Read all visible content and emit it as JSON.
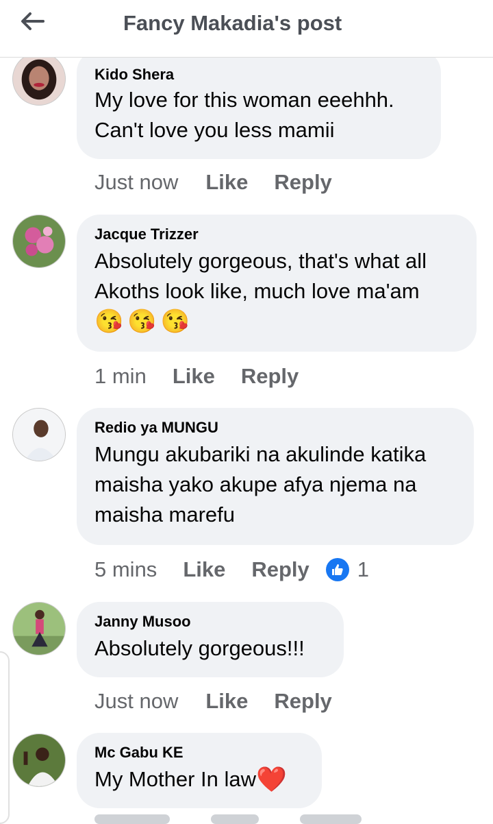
{
  "header": {
    "title": "Fancy Makadia's post"
  },
  "comments": [
    {
      "author": "Kido Shera",
      "lines": [
        "My love for this woman eeehhh.",
        "Can't love you less mamii"
      ],
      "time": "Just now",
      "like_label": "Like",
      "reply_label": "Reply"
    },
    {
      "author": "Jacque Trizzer",
      "lines": [
        "Absolutely gorgeous, that's what all",
        "Akoths look like, much love ma'am"
      ],
      "emojis": [
        "😘",
        "😘",
        "😘"
      ],
      "time": "1 min",
      "like_label": "Like",
      "reply_label": "Reply"
    },
    {
      "author": "Redio ya MUNGU",
      "lines": [
        "Mungu akubariki na akulinde katika",
        "maisha yako akupe afya njema na",
        "maisha marefu"
      ],
      "time": "5 mins",
      "like_label": "Like",
      "reply_label": "Reply",
      "reaction_count": "1"
    },
    {
      "author": "Janny Musoo",
      "lines": [
        "Absolutely gorgeous!!!"
      ],
      "time": "Just now",
      "like_label": "Like",
      "reply_label": "Reply"
    },
    {
      "author": "Mc Gabu KE",
      "lines": [
        "My Mother In law"
      ],
      "emoji": "❤️"
    }
  ],
  "colors": {
    "bubble": "#f0f2f5",
    "meta": "#65676b",
    "like_badge": "#1877f2",
    "heart": "#e41e3f"
  }
}
